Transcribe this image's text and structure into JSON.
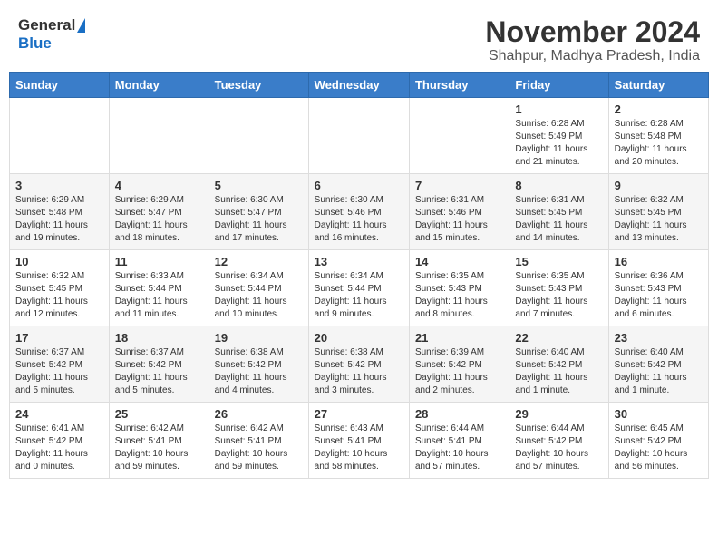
{
  "header": {
    "logo_general": "General",
    "logo_blue": "Blue",
    "month_title": "November 2024",
    "subtitle": "Shahpur, Madhya Pradesh, India"
  },
  "days_of_week": [
    "Sunday",
    "Monday",
    "Tuesday",
    "Wednesday",
    "Thursday",
    "Friday",
    "Saturday"
  ],
  "weeks": [
    [
      {
        "day": "",
        "sunrise": "",
        "sunset": "",
        "daylight": ""
      },
      {
        "day": "",
        "sunrise": "",
        "sunset": "",
        "daylight": ""
      },
      {
        "day": "",
        "sunrise": "",
        "sunset": "",
        "daylight": ""
      },
      {
        "day": "",
        "sunrise": "",
        "sunset": "",
        "daylight": ""
      },
      {
        "day": "",
        "sunrise": "",
        "sunset": "",
        "daylight": ""
      },
      {
        "day": "1",
        "sunrise": "Sunrise: 6:28 AM",
        "sunset": "Sunset: 5:49 PM",
        "daylight": "Daylight: 11 hours and 21 minutes."
      },
      {
        "day": "2",
        "sunrise": "Sunrise: 6:28 AM",
        "sunset": "Sunset: 5:48 PM",
        "daylight": "Daylight: 11 hours and 20 minutes."
      }
    ],
    [
      {
        "day": "3",
        "sunrise": "Sunrise: 6:29 AM",
        "sunset": "Sunset: 5:48 PM",
        "daylight": "Daylight: 11 hours and 19 minutes."
      },
      {
        "day": "4",
        "sunrise": "Sunrise: 6:29 AM",
        "sunset": "Sunset: 5:47 PM",
        "daylight": "Daylight: 11 hours and 18 minutes."
      },
      {
        "day": "5",
        "sunrise": "Sunrise: 6:30 AM",
        "sunset": "Sunset: 5:47 PM",
        "daylight": "Daylight: 11 hours and 17 minutes."
      },
      {
        "day": "6",
        "sunrise": "Sunrise: 6:30 AM",
        "sunset": "Sunset: 5:46 PM",
        "daylight": "Daylight: 11 hours and 16 minutes."
      },
      {
        "day": "7",
        "sunrise": "Sunrise: 6:31 AM",
        "sunset": "Sunset: 5:46 PM",
        "daylight": "Daylight: 11 hours and 15 minutes."
      },
      {
        "day": "8",
        "sunrise": "Sunrise: 6:31 AM",
        "sunset": "Sunset: 5:45 PM",
        "daylight": "Daylight: 11 hours and 14 minutes."
      },
      {
        "day": "9",
        "sunrise": "Sunrise: 6:32 AM",
        "sunset": "Sunset: 5:45 PM",
        "daylight": "Daylight: 11 hours and 13 minutes."
      }
    ],
    [
      {
        "day": "10",
        "sunrise": "Sunrise: 6:32 AM",
        "sunset": "Sunset: 5:45 PM",
        "daylight": "Daylight: 11 hours and 12 minutes."
      },
      {
        "day": "11",
        "sunrise": "Sunrise: 6:33 AM",
        "sunset": "Sunset: 5:44 PM",
        "daylight": "Daylight: 11 hours and 11 minutes."
      },
      {
        "day": "12",
        "sunrise": "Sunrise: 6:34 AM",
        "sunset": "Sunset: 5:44 PM",
        "daylight": "Daylight: 11 hours and 10 minutes."
      },
      {
        "day": "13",
        "sunrise": "Sunrise: 6:34 AM",
        "sunset": "Sunset: 5:44 PM",
        "daylight": "Daylight: 11 hours and 9 minutes."
      },
      {
        "day": "14",
        "sunrise": "Sunrise: 6:35 AM",
        "sunset": "Sunset: 5:43 PM",
        "daylight": "Daylight: 11 hours and 8 minutes."
      },
      {
        "day": "15",
        "sunrise": "Sunrise: 6:35 AM",
        "sunset": "Sunset: 5:43 PM",
        "daylight": "Daylight: 11 hours and 7 minutes."
      },
      {
        "day": "16",
        "sunrise": "Sunrise: 6:36 AM",
        "sunset": "Sunset: 5:43 PM",
        "daylight": "Daylight: 11 hours and 6 minutes."
      }
    ],
    [
      {
        "day": "17",
        "sunrise": "Sunrise: 6:37 AM",
        "sunset": "Sunset: 5:42 PM",
        "daylight": "Daylight: 11 hours and 5 minutes."
      },
      {
        "day": "18",
        "sunrise": "Sunrise: 6:37 AM",
        "sunset": "Sunset: 5:42 PM",
        "daylight": "Daylight: 11 hours and 5 minutes."
      },
      {
        "day": "19",
        "sunrise": "Sunrise: 6:38 AM",
        "sunset": "Sunset: 5:42 PM",
        "daylight": "Daylight: 11 hours and 4 minutes."
      },
      {
        "day": "20",
        "sunrise": "Sunrise: 6:38 AM",
        "sunset": "Sunset: 5:42 PM",
        "daylight": "Daylight: 11 hours and 3 minutes."
      },
      {
        "day": "21",
        "sunrise": "Sunrise: 6:39 AM",
        "sunset": "Sunset: 5:42 PM",
        "daylight": "Daylight: 11 hours and 2 minutes."
      },
      {
        "day": "22",
        "sunrise": "Sunrise: 6:40 AM",
        "sunset": "Sunset: 5:42 PM",
        "daylight": "Daylight: 11 hours and 1 minute."
      },
      {
        "day": "23",
        "sunrise": "Sunrise: 6:40 AM",
        "sunset": "Sunset: 5:42 PM",
        "daylight": "Daylight: 11 hours and 1 minute."
      }
    ],
    [
      {
        "day": "24",
        "sunrise": "Sunrise: 6:41 AM",
        "sunset": "Sunset: 5:42 PM",
        "daylight": "Daylight: 11 hours and 0 minutes."
      },
      {
        "day": "25",
        "sunrise": "Sunrise: 6:42 AM",
        "sunset": "Sunset: 5:41 PM",
        "daylight": "Daylight: 10 hours and 59 minutes."
      },
      {
        "day": "26",
        "sunrise": "Sunrise: 6:42 AM",
        "sunset": "Sunset: 5:41 PM",
        "daylight": "Daylight: 10 hours and 59 minutes."
      },
      {
        "day": "27",
        "sunrise": "Sunrise: 6:43 AM",
        "sunset": "Sunset: 5:41 PM",
        "daylight": "Daylight: 10 hours and 58 minutes."
      },
      {
        "day": "28",
        "sunrise": "Sunrise: 6:44 AM",
        "sunset": "Sunset: 5:41 PM",
        "daylight": "Daylight: 10 hours and 57 minutes."
      },
      {
        "day": "29",
        "sunrise": "Sunrise: 6:44 AM",
        "sunset": "Sunset: 5:42 PM",
        "daylight": "Daylight: 10 hours and 57 minutes."
      },
      {
        "day": "30",
        "sunrise": "Sunrise: 6:45 AM",
        "sunset": "Sunset: 5:42 PM",
        "daylight": "Daylight: 10 hours and 56 minutes."
      }
    ]
  ]
}
